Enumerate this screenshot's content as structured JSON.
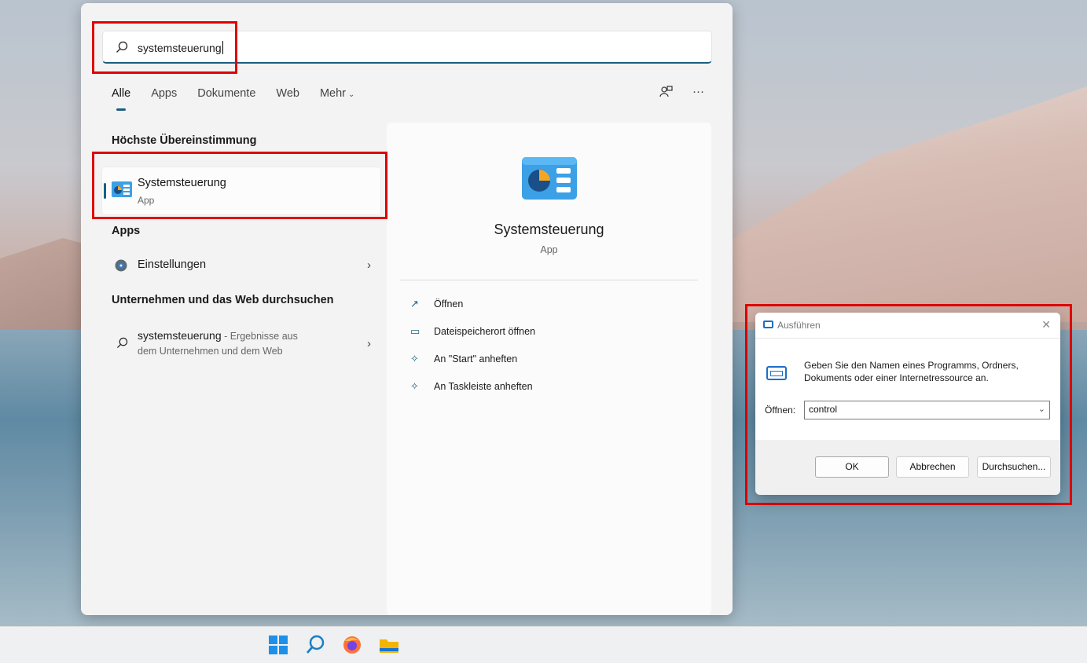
{
  "search": {
    "value": "systemsteuerung"
  },
  "tabs": [
    {
      "label": "Alle"
    },
    {
      "label": "Apps"
    },
    {
      "label": "Dokumente"
    },
    {
      "label": "Web"
    },
    {
      "label": "Mehr"
    }
  ],
  "top_icons": {
    "more": "···"
  },
  "sections": {
    "best_match": "Höchste Übereinstimmung",
    "apps": "Apps",
    "web": "Unternehmen und das Web durchsuchen"
  },
  "best_match": {
    "title": "Systemsteuerung",
    "type": "App"
  },
  "apps_list": [
    {
      "label": "Einstellungen"
    }
  ],
  "web_result": {
    "query": "systemsteuerung",
    "suffix": " - Ergebnisse aus",
    "line2": "dem Unternehmen und dem Web"
  },
  "preview": {
    "name": "Systemsteuerung",
    "type": "App",
    "actions": [
      {
        "label": "Öffnen",
        "icon": "open-icon"
      },
      {
        "label": "Dateispeicherort öffnen",
        "icon": "folder-icon"
      },
      {
        "label": "An \"Start\" anheften",
        "icon": "pin-icon"
      },
      {
        "label": "An Taskleiste anheften",
        "icon": "pin-icon"
      }
    ]
  },
  "run_dialog": {
    "title": "Ausführen",
    "description": "Geben Sie den Namen eines Programms, Ordners, Dokuments oder einer Internetressource an.",
    "open_label": "Öffnen:",
    "open_value": "control",
    "buttons": {
      "ok": "OK",
      "cancel": "Abbrechen",
      "browse": "Durchsuchen..."
    }
  },
  "colors": {
    "accent": "#1b5f80",
    "highlight": "#e00000"
  }
}
